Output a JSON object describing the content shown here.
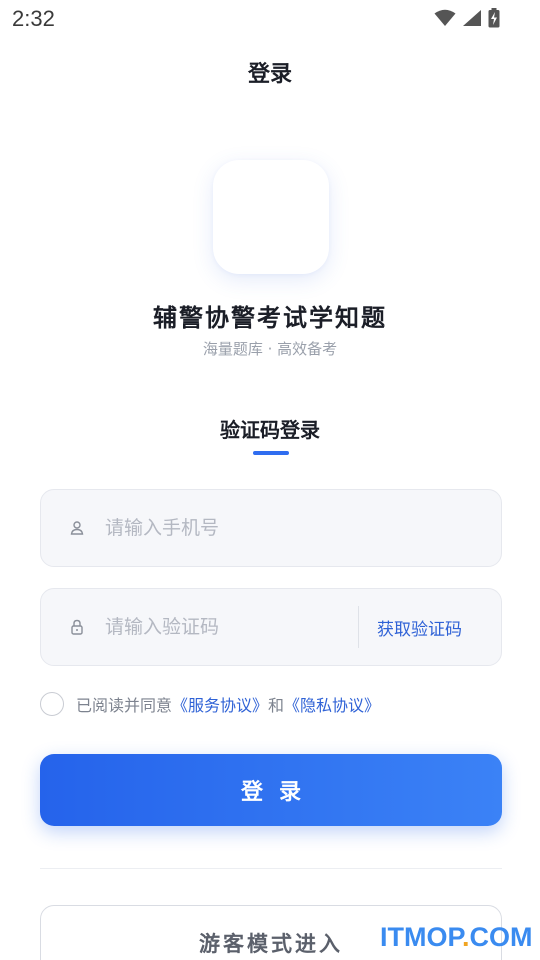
{
  "status_bar": {
    "time": "2:32",
    "icons": [
      "wifi-icon",
      "cell-signal-icon",
      "battery-charging-icon"
    ]
  },
  "header": {
    "title": "登录"
  },
  "app": {
    "name": "辅警协警考试学知题",
    "slogan": "海量题库 · 高效备考"
  },
  "tab": {
    "label": "验证码登录"
  },
  "form": {
    "phone": {
      "placeholder": "请输入手机号",
      "value": "",
      "icon": "user-icon"
    },
    "code": {
      "placeholder": "请输入验证码",
      "value": "",
      "icon": "lock-icon",
      "get_code_label": "获取验证码"
    }
  },
  "agreement": {
    "checked": false,
    "prefix": "已阅读并同意",
    "service_link": "《服务协议》",
    "and": "和",
    "privacy_link": "《隐私协议》"
  },
  "login_button": {
    "label": "登录"
  },
  "guest_button": {
    "label": "游客模式进入"
  },
  "watermark": {
    "text_main": "ITMOP",
    "text_dot": ".",
    "text_tail": "COM"
  },
  "colors": {
    "accent": "#2f6df0",
    "link": "#2f62d6",
    "button_gradient_start": "#2563eb",
    "button_gradient_end": "#3b82f6",
    "watermark": "#3a8bf0"
  }
}
